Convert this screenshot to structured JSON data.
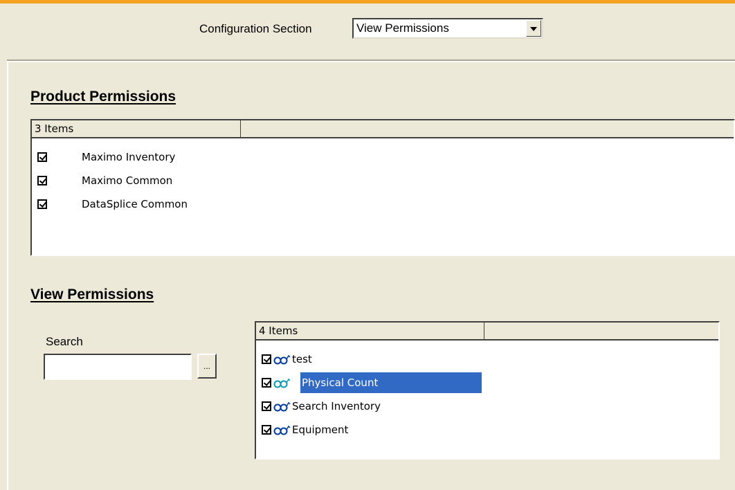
{
  "config": {
    "label": "Configuration Section",
    "selected_value": "View Permissions"
  },
  "product_permissions": {
    "title": "Product Permissions",
    "columns": [
      "3 Items",
      ""
    ],
    "items": [
      {
        "label": "Maximo Inventory",
        "checked": true
      },
      {
        "label": "Maximo Common",
        "checked": true
      },
      {
        "label": "DataSplice Common",
        "checked": true
      }
    ]
  },
  "view_permissions": {
    "title": "View Permissions",
    "search_label": "Search",
    "search_value": "",
    "browse_label": "...",
    "columns": [
      "4 Items",
      ""
    ],
    "items": [
      {
        "label": "test",
        "checked": true,
        "icon": "glasses-icon",
        "selected": false
      },
      {
        "label": "Physical Count",
        "checked": true,
        "icon": "glasses-icon",
        "selected": true
      },
      {
        "label": "Search Inventory",
        "checked": true,
        "icon": "glasses-icon",
        "selected": false
      },
      {
        "label": "Equipment",
        "checked": true,
        "icon": "glasses-icon",
        "selected": false
      }
    ]
  },
  "colors": {
    "accent": "#f5a31f",
    "selection": "#316ac5",
    "background": "#ece9d8"
  }
}
